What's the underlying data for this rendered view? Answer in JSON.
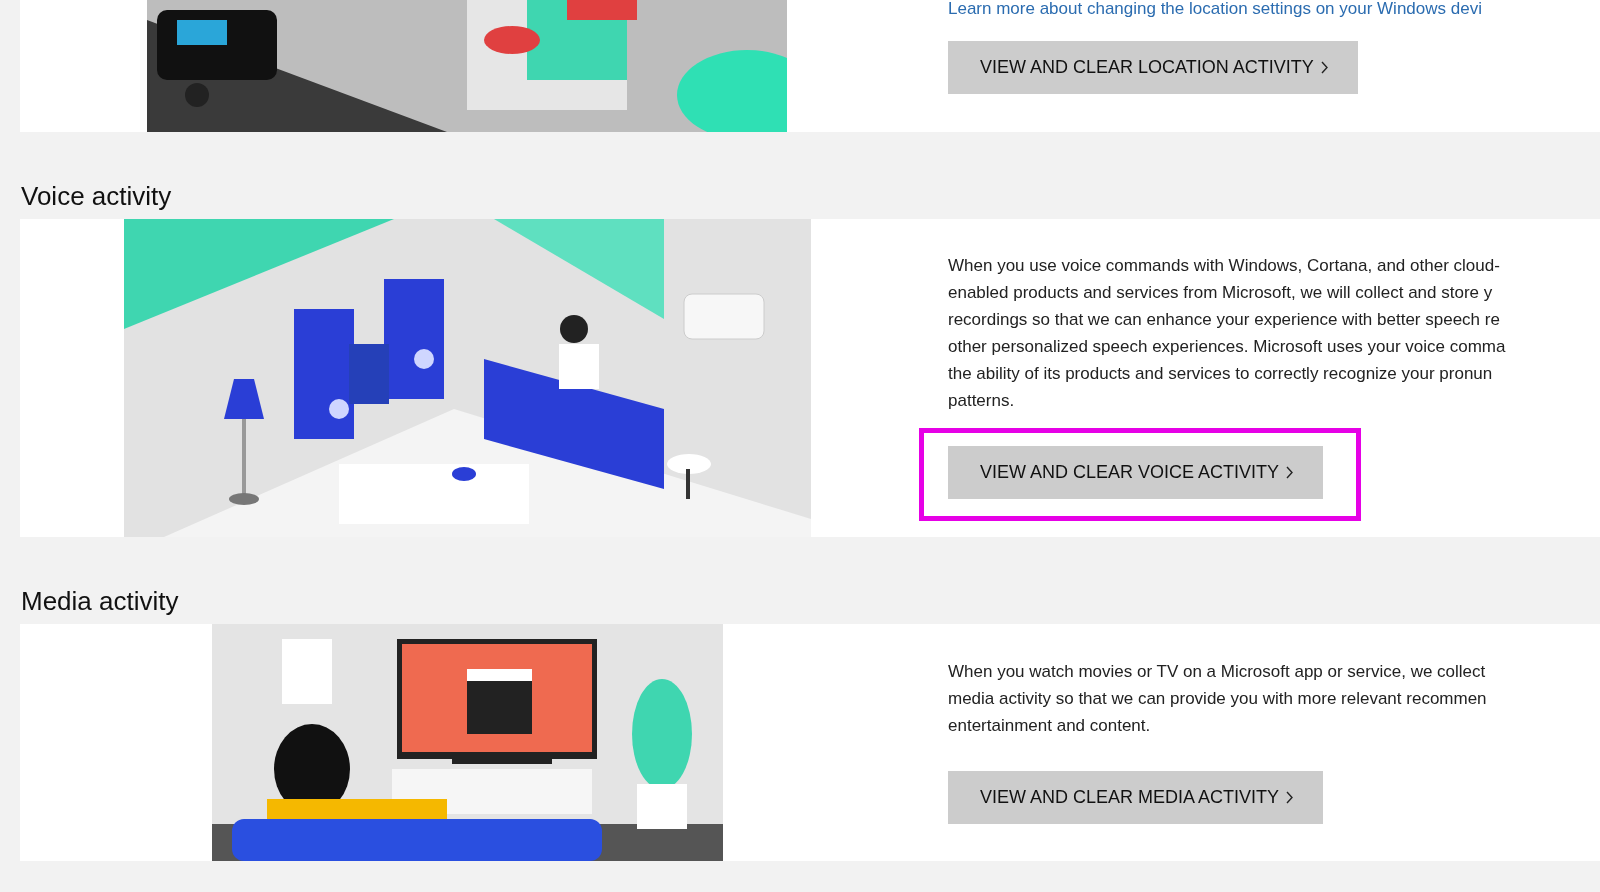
{
  "location_section": {
    "link": "Learn more about changing the location settings on your Windows devi",
    "button": "VIEW AND CLEAR LOCATION ACTIVITY"
  },
  "sections": [
    {
      "kind": "voice",
      "heading": "Voice activity",
      "description_lines": [
        "When you use voice commands with Windows, Cortana, and other cloud-",
        "enabled products and services from Microsoft, we will collect and store y",
        "recordings so that we can enhance your experience with better speech re",
        "other personalized speech experiences. Microsoft uses your voice comma",
        "the ability of its products and services to correctly recognize your pronun",
        "patterns."
      ],
      "button": "VIEW AND CLEAR VOICE ACTIVITY",
      "highlighted": true
    },
    {
      "kind": "media",
      "heading": "Media activity",
      "description_lines": [
        "When you watch movies or TV on a Microsoft app or service, we collect",
        "media activity so that we can provide you with more relevant recommen",
        "entertainment and content."
      ],
      "button": "VIEW AND CLEAR MEDIA ACTIVITY",
      "highlighted": false
    }
  ]
}
